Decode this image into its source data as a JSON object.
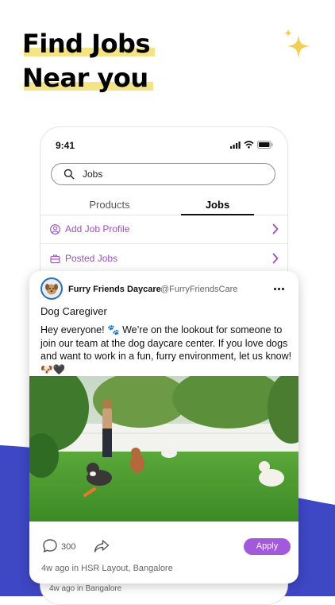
{
  "headline": {
    "line1": "Find Jobs",
    "line2": "Near you"
  },
  "phone": {
    "status_time": "9:41",
    "search": {
      "value": "Jobs"
    },
    "tabs": [
      {
        "label": "Products",
        "active": false
      },
      {
        "label": "Jobs",
        "active": true
      }
    ],
    "menu": [
      {
        "label": "Add Job Profile",
        "icon": "user-circle-icon"
      },
      {
        "label": "Posted Jobs",
        "icon": "briefcase-icon"
      }
    ],
    "footer_meta": "4w ago in Bangalore"
  },
  "post": {
    "poster_name": "Furry Friends Daycare",
    "poster_handle": "@FurryFriendsCare",
    "title": "Dog Caregiver",
    "body": "Hey everyone! 🐾 We’re on the lookout for someone to join our team at the dog daycare center. If you love dogs and want to work in a fun, furry environment, let us know! 🐶🖤",
    "comment_count": "300",
    "apply_label": "Apply",
    "meta": "4w ago in HSR Layout, Bangalore"
  },
  "colors": {
    "accent": "#a259dc",
    "link_purple": "#a04cc3",
    "highlight_yellow": "#f5e487",
    "sparkle_yellow": "#f1cf55",
    "background_blue": "#3e47c4"
  }
}
